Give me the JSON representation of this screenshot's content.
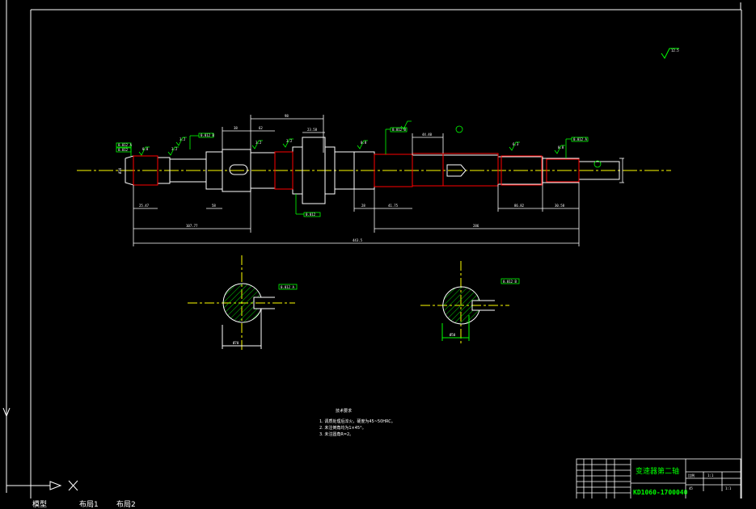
{
  "drawing": {
    "roughness_symbol": "12.5",
    "shaft_label_left": "Ø30",
    "dims": {
      "top_98": "98",
      "top_62": "62",
      "top_38": "38",
      "top_48": "48",
      "top_2358": "23.58",
      "top_4440": "44.40",
      "bot_2547": "25.47",
      "bot_10777": "107.77",
      "bot_58": "58",
      "bot_28": "28",
      "bot_4175": "41.75",
      "bot_8682": "86.82",
      "bot_3058": "30.58",
      "bot_total_right": "286",
      "bot_total": "443.5",
      "sec_left_width": "Ø70",
      "sec_right_width": "Ø50"
    },
    "tolerance_frames": [
      "0.012 A",
      "0.012",
      "0.012 B",
      "0.012",
      "0.012 B",
      "0.012 A",
      "0.012 A",
      "0.012 B",
      "0.012 B"
    ],
    "roughness_values": [
      "0.8",
      "3.2",
      "3.2",
      "3.2",
      "3.2",
      "0.8",
      "6.3",
      "0.8"
    ],
    "tech_notes": {
      "title": "技术要求",
      "lines": [
        "1. 调质处理后淬火，硬度为45~50HRC。",
        "2. 未注倒角均为1×45°。",
        "3. 未注圆角R=2。"
      ]
    },
    "title_block": {
      "name": "变速器第二轴",
      "code": "KD1060-1700040",
      "cells": [
        "比例",
        "1:1",
        "45",
        "1:1"
      ]
    }
  },
  "layout_tabs": {
    "model": "模型",
    "layout1": "布局1",
    "layout2": "布局2"
  },
  "colors": {
    "background": "#000000",
    "lines": "#ffffff",
    "annotation": "#00ff00",
    "centerline": "#ffff00",
    "hidden": "#ff0000"
  }
}
